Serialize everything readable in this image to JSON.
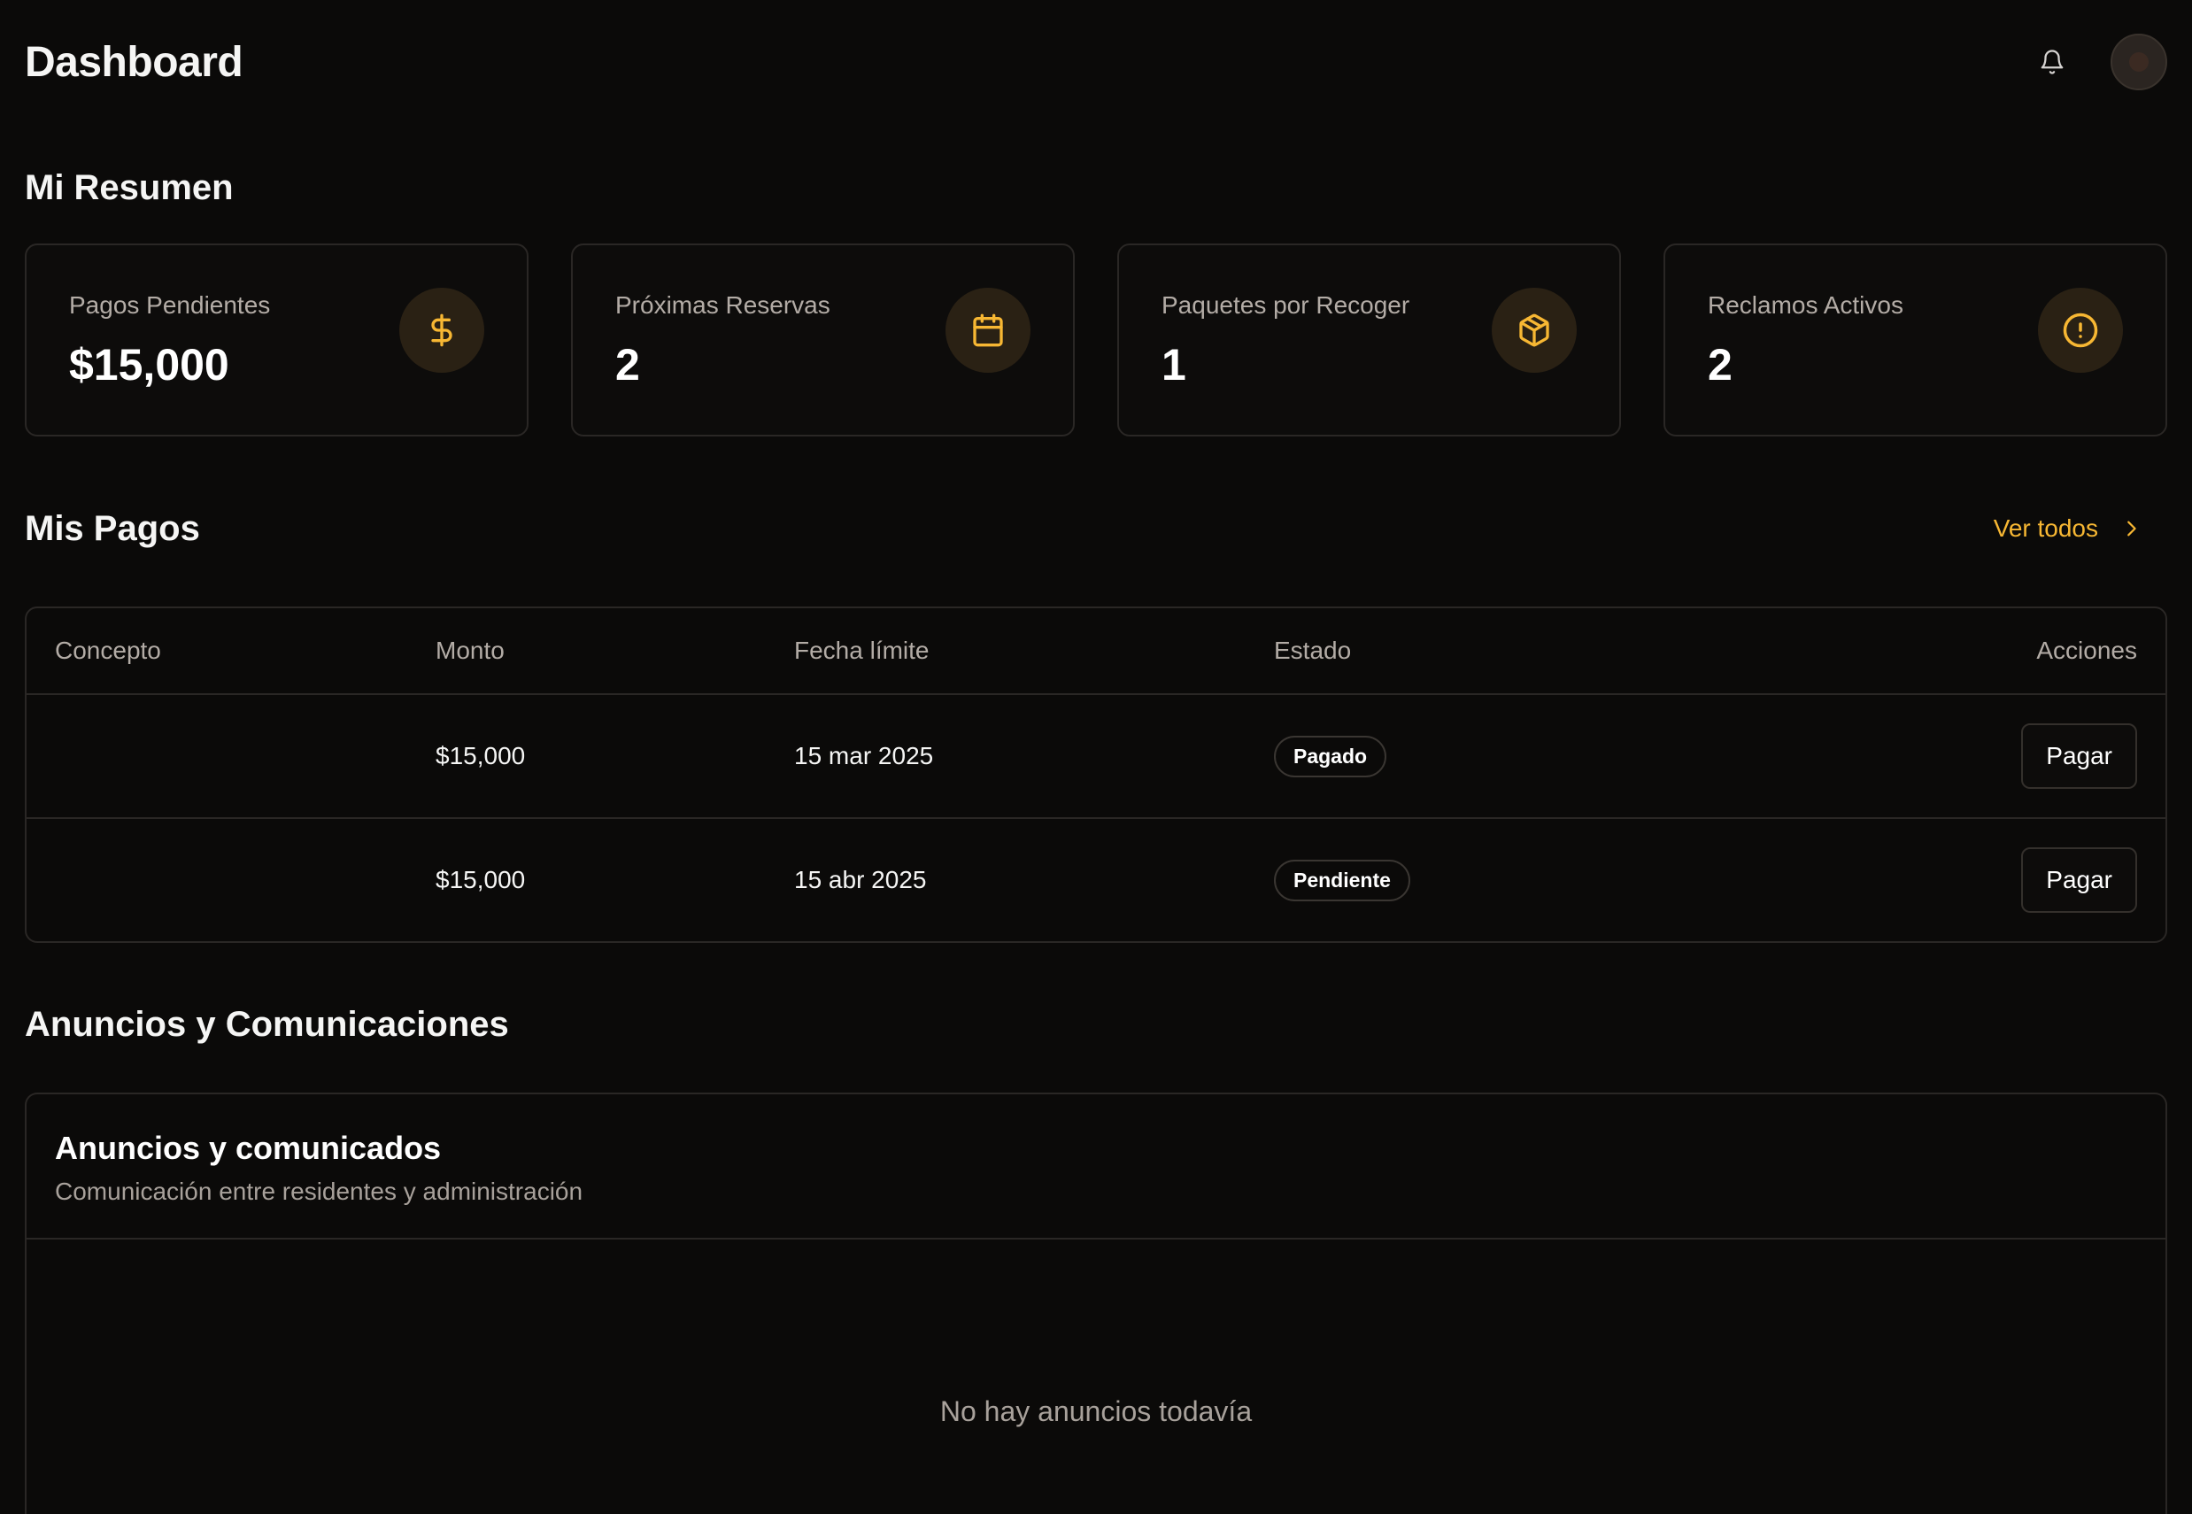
{
  "header": {
    "title": "Dashboard",
    "notifications_icon": "bell-icon",
    "avatar_icon": "avatar"
  },
  "summary": {
    "title": "Mi Resumen",
    "cards": [
      {
        "label": "Pagos Pendientes",
        "value": "$15,000",
        "icon": "dollar-icon"
      },
      {
        "label": "Próximas Reservas",
        "value": "2",
        "icon": "calendar-icon"
      },
      {
        "label": "Paquetes por Recoger",
        "value": "1",
        "icon": "package-icon"
      },
      {
        "label": "Reclamos Activos",
        "value": "2",
        "icon": "alert-circle-icon"
      }
    ]
  },
  "payments": {
    "title": "Mis Pagos",
    "see_all": "Ver todos",
    "columns": [
      "Concepto",
      "Monto",
      "Fecha límite",
      "Estado",
      "Acciones"
    ],
    "rows": [
      {
        "concept": "",
        "amount": "$15,000",
        "due": "15 mar 2025",
        "status": "Pagado",
        "action": "Pagar"
      },
      {
        "concept": "",
        "amount": "$15,000",
        "due": "15 abr 2025",
        "status": "Pendiente",
        "action": "Pagar"
      }
    ]
  },
  "announcements": {
    "title": "Anuncios y Comunicaciones",
    "card_title": "Anuncios y comunicados",
    "card_subtitle": "Comunicación entre residentes y administración",
    "empty": "No hay anuncios todavía"
  },
  "colors": {
    "background": "#0b0a09",
    "accent": "#f7b733",
    "border": "#2a2725"
  }
}
